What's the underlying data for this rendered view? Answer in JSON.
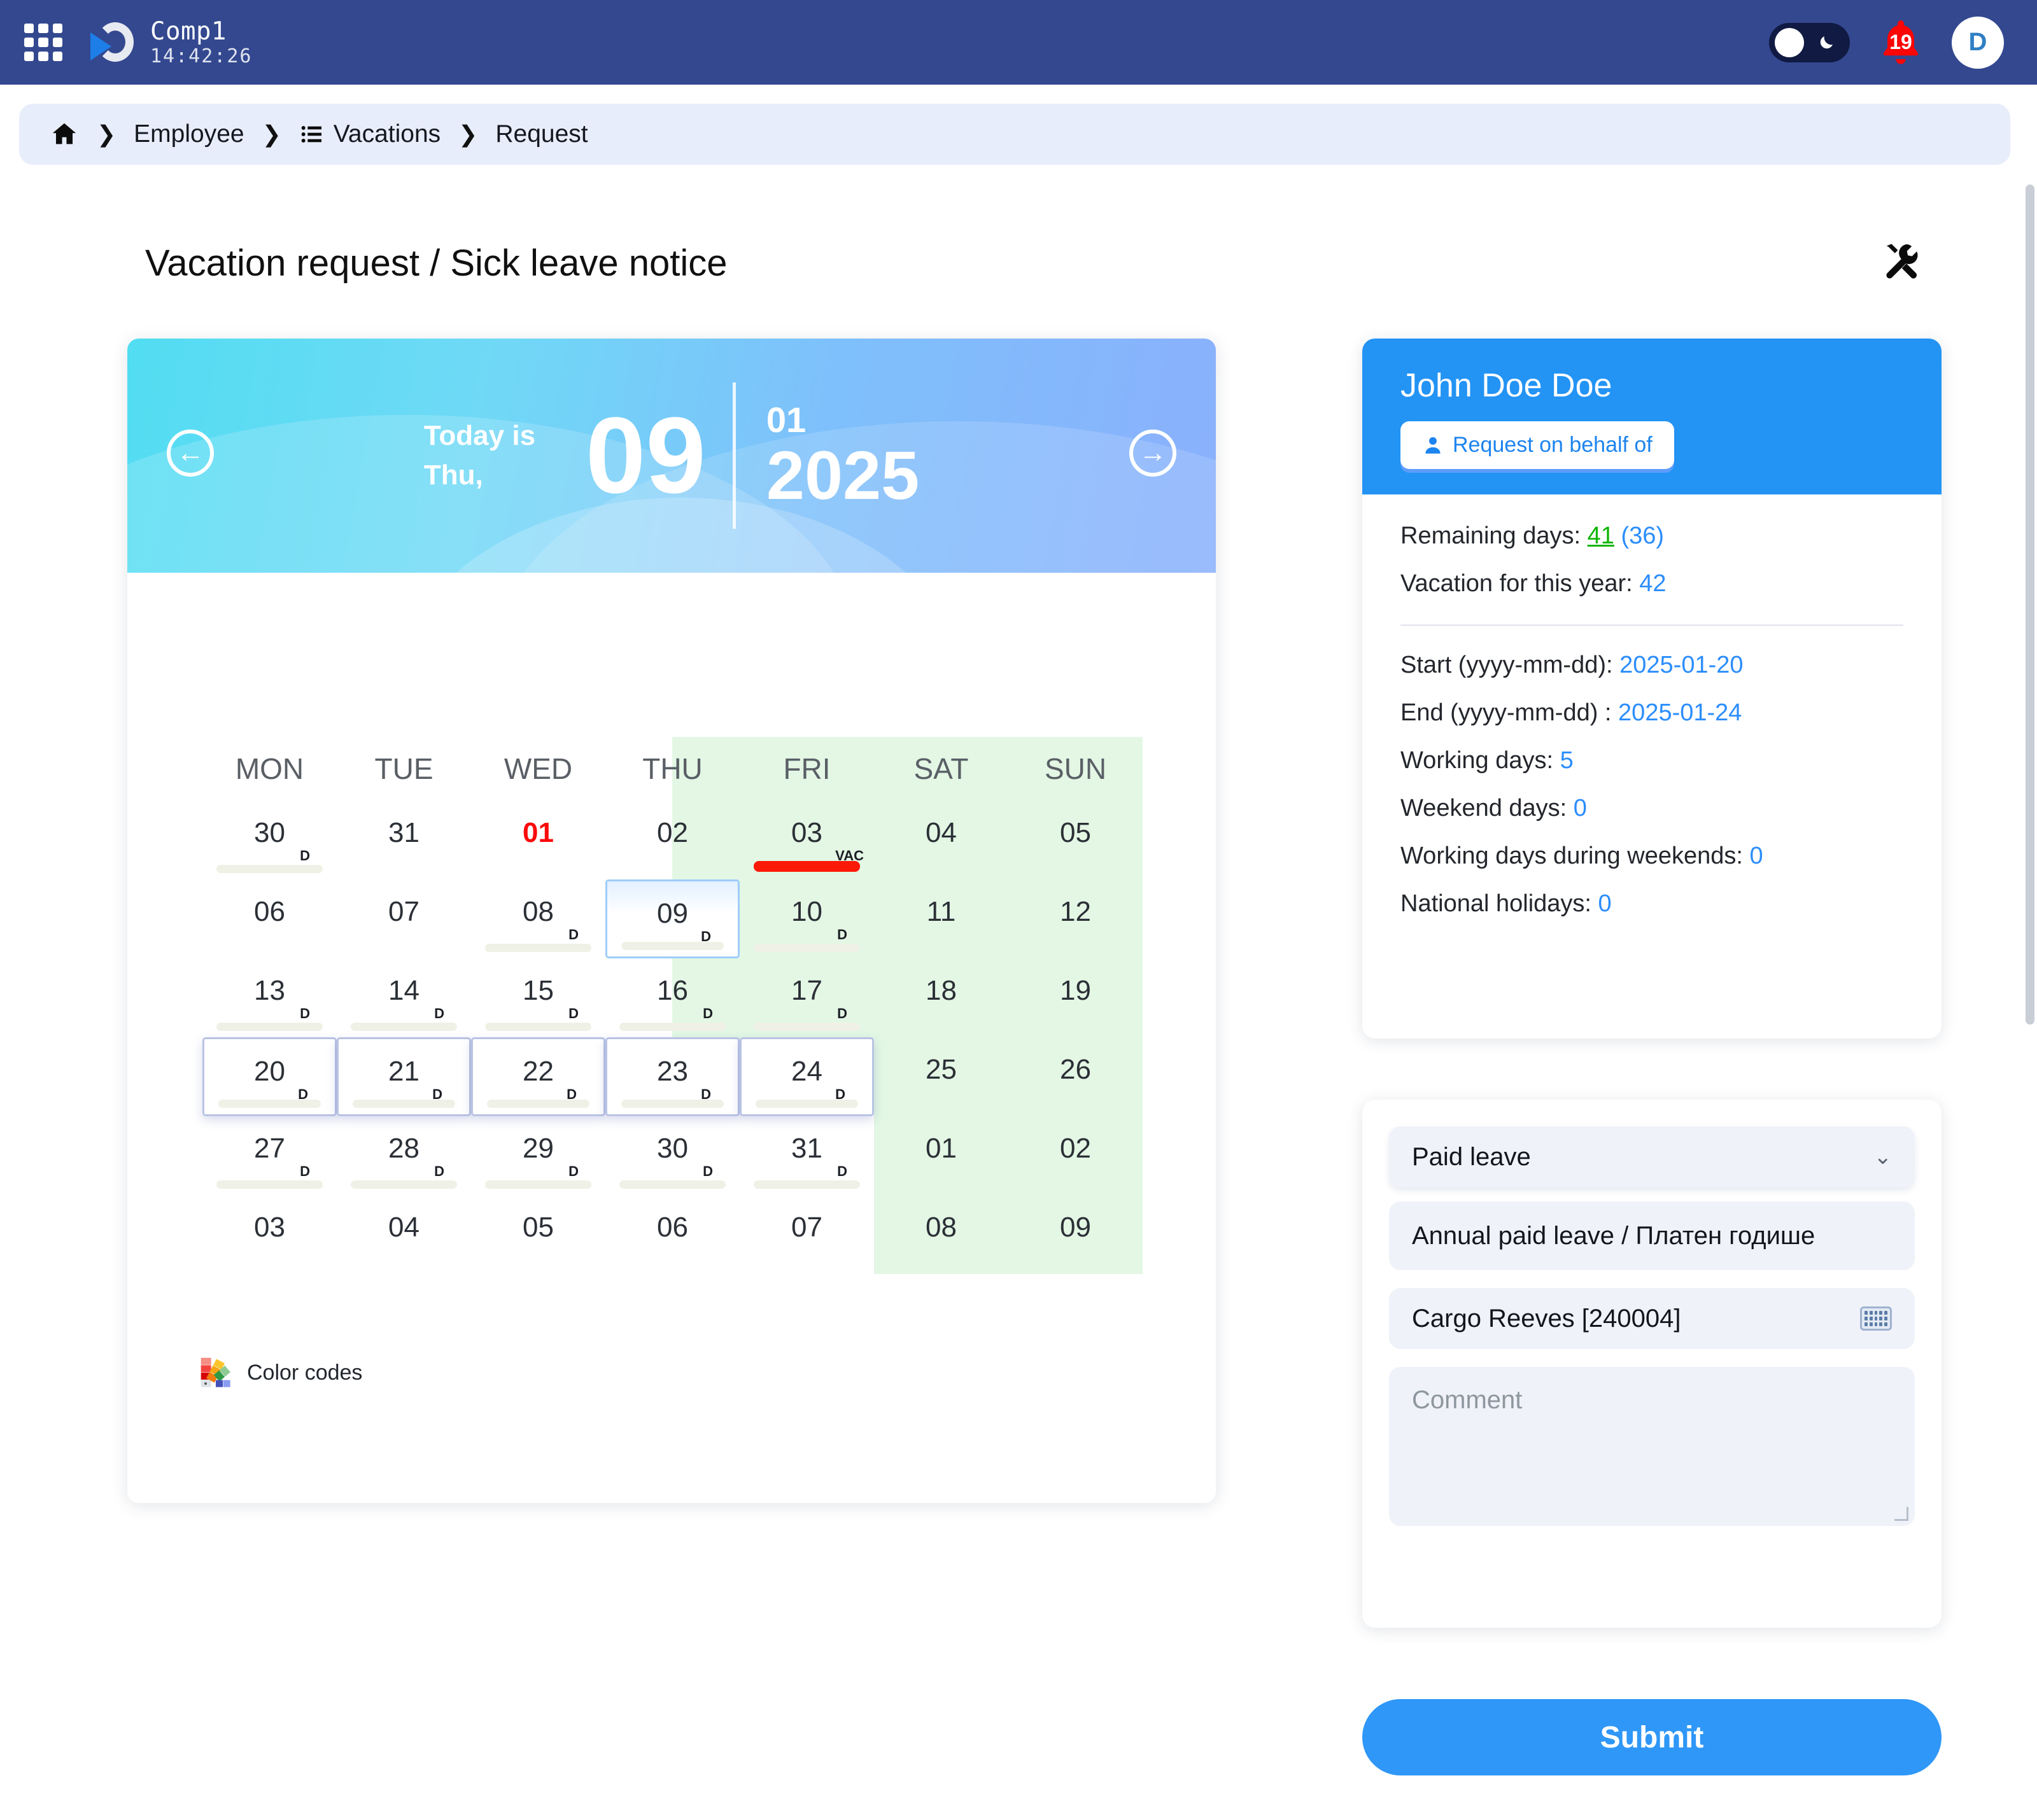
{
  "topbar": {
    "brand_name": "Comp1",
    "time": "14:42:26",
    "notification_count": "19",
    "avatar_initial": "D",
    "accent_bg": "#33488f"
  },
  "breadcrumb": {
    "home": "⌂",
    "sep": "❯",
    "items": [
      {
        "label": "Employee"
      },
      {
        "label": "Vacations"
      },
      {
        "label": "Request"
      }
    ]
  },
  "page": {
    "title": "Vacation request / Sick leave notice",
    "tools_icon": "⚒"
  },
  "calendar": {
    "today_label": "Today is Thu,",
    "today_day": "09",
    "month": "01",
    "year": "2025",
    "prev_arrow": "←",
    "next_arrow": "→",
    "dow": [
      "MON",
      "TUE",
      "WED",
      "THU",
      "FRI",
      "SAT",
      "SUN"
    ],
    "color_codes_label": "Color codes",
    "weeks": [
      [
        {
          "d": "30",
          "tag": "D",
          "bar": "beige"
        },
        {
          "d": "31"
        },
        {
          "d": "01",
          "red": true
        },
        {
          "d": "02"
        },
        {
          "d": "03",
          "tag": "VAC",
          "bar": "red"
        },
        {
          "d": "04",
          "weekend": true
        },
        {
          "d": "05",
          "weekend": true
        }
      ],
      [
        {
          "d": "06"
        },
        {
          "d": "07"
        },
        {
          "d": "08",
          "tag": "D",
          "bar": "beige"
        },
        {
          "d": "09",
          "tag": "D",
          "bar": "beige",
          "today": true
        },
        {
          "d": "10",
          "tag": "D",
          "bar": "beige"
        },
        {
          "d": "11",
          "weekend": true
        },
        {
          "d": "12",
          "weekend": true
        }
      ],
      [
        {
          "d": "13",
          "tag": "D",
          "bar": "beige"
        },
        {
          "d": "14",
          "tag": "D",
          "bar": "beige"
        },
        {
          "d": "15",
          "tag": "D",
          "bar": "beige"
        },
        {
          "d": "16",
          "tag": "D",
          "bar": "beige"
        },
        {
          "d": "17",
          "tag": "D",
          "bar": "beige"
        },
        {
          "d": "18",
          "weekend": true
        },
        {
          "d": "19",
          "weekend": true
        }
      ],
      [
        {
          "d": "20",
          "tag": "D",
          "bar": "beige",
          "selected": true
        },
        {
          "d": "21",
          "tag": "D",
          "bar": "beige",
          "selected": true
        },
        {
          "d": "22",
          "tag": "D",
          "bar": "beige",
          "selected": true
        },
        {
          "d": "23",
          "tag": "D",
          "bar": "beige",
          "selected": true
        },
        {
          "d": "24",
          "tag": "D",
          "bar": "beige",
          "selected": true
        },
        {
          "d": "25",
          "weekend": true
        },
        {
          "d": "26",
          "weekend": true
        }
      ],
      [
        {
          "d": "27",
          "tag": "D",
          "bar": "beige"
        },
        {
          "d": "28",
          "tag": "D",
          "bar": "beige"
        },
        {
          "d": "29",
          "tag": "D",
          "bar": "beige"
        },
        {
          "d": "30",
          "tag": "D",
          "bar": "beige"
        },
        {
          "d": "31",
          "tag": "D",
          "bar": "beige"
        },
        {
          "d": "01",
          "weekend": true
        },
        {
          "d": "02",
          "weekend": true
        }
      ],
      [
        {
          "d": "03"
        },
        {
          "d": "04"
        },
        {
          "d": "05"
        },
        {
          "d": "06"
        },
        {
          "d": "07"
        },
        {
          "d": "08",
          "weekend": true
        },
        {
          "d": "09",
          "weekend": true
        }
      ]
    ]
  },
  "info": {
    "employee_name": "John Doe Doe",
    "behalf_button": "Request on behalf of",
    "remaining_label": "Remaining days:",
    "remaining_value": "41",
    "remaining_paren": "(36)",
    "vacation_year_label": "Vacation for this year:",
    "vacation_year_value": "42",
    "rows": [
      {
        "label": "Start (yyyy-mm-dd):",
        "value": "2025-01-20"
      },
      {
        "label": "End (yyyy-mm-dd) :",
        "value": "2025-01-24"
      },
      {
        "label": "Working days:",
        "value": "5"
      },
      {
        "label": "Weekend days:",
        "value": "0"
      },
      {
        "label": "Working days during weekends:",
        "value": "0"
      },
      {
        "label": "National holidays:",
        "value": "0"
      }
    ]
  },
  "form": {
    "leave_type": "Paid leave",
    "leave_option": "Annual paid leave / Платен годише",
    "substitute": "Cargo Reeves [240004]",
    "comment_placeholder": "Comment",
    "chevron": "⌄",
    "submit_label": "Submit"
  }
}
